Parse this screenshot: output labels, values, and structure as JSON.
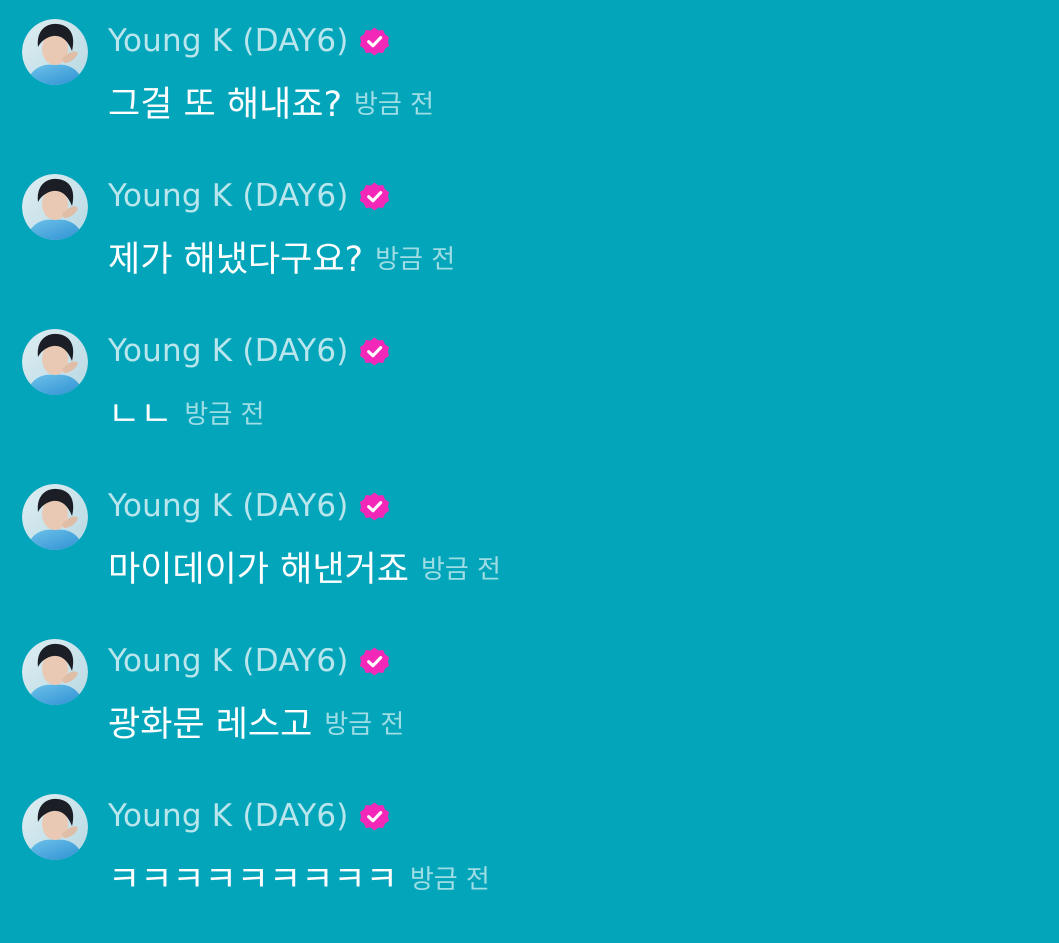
{
  "colors": {
    "background": "#03a5bb",
    "badge": "#f428b8",
    "name_text": "#b9e3ea",
    "message_text": "#ffffff",
    "time_text": "#a6dbe3"
  },
  "messages": [
    {
      "author": "Young K (DAY6)",
      "verified_icon": "verified-badge-icon",
      "text": "그걸 또 해내죠?",
      "time": "방금 전"
    },
    {
      "author": "Young K (DAY6)",
      "verified_icon": "verified-badge-icon",
      "text": "제가 해냈다구요?",
      "time": "방금 전"
    },
    {
      "author": "Young K (DAY6)",
      "verified_icon": "verified-badge-icon",
      "text": "ㄴㄴ",
      "time": "방금 전"
    },
    {
      "author": "Young K (DAY6)",
      "verified_icon": "verified-badge-icon",
      "text": "마이데이가 해낸거죠",
      "time": "방금 전"
    },
    {
      "author": "Young K (DAY6)",
      "verified_icon": "verified-badge-icon",
      "text": "광화문 레스고",
      "time": "방금 전"
    },
    {
      "author": "Young K (DAY6)",
      "verified_icon": "verified-badge-icon",
      "text": "ㅋㅋㅋㅋㅋㅋㅋㅋㅋ",
      "time": "방금 전"
    }
  ]
}
